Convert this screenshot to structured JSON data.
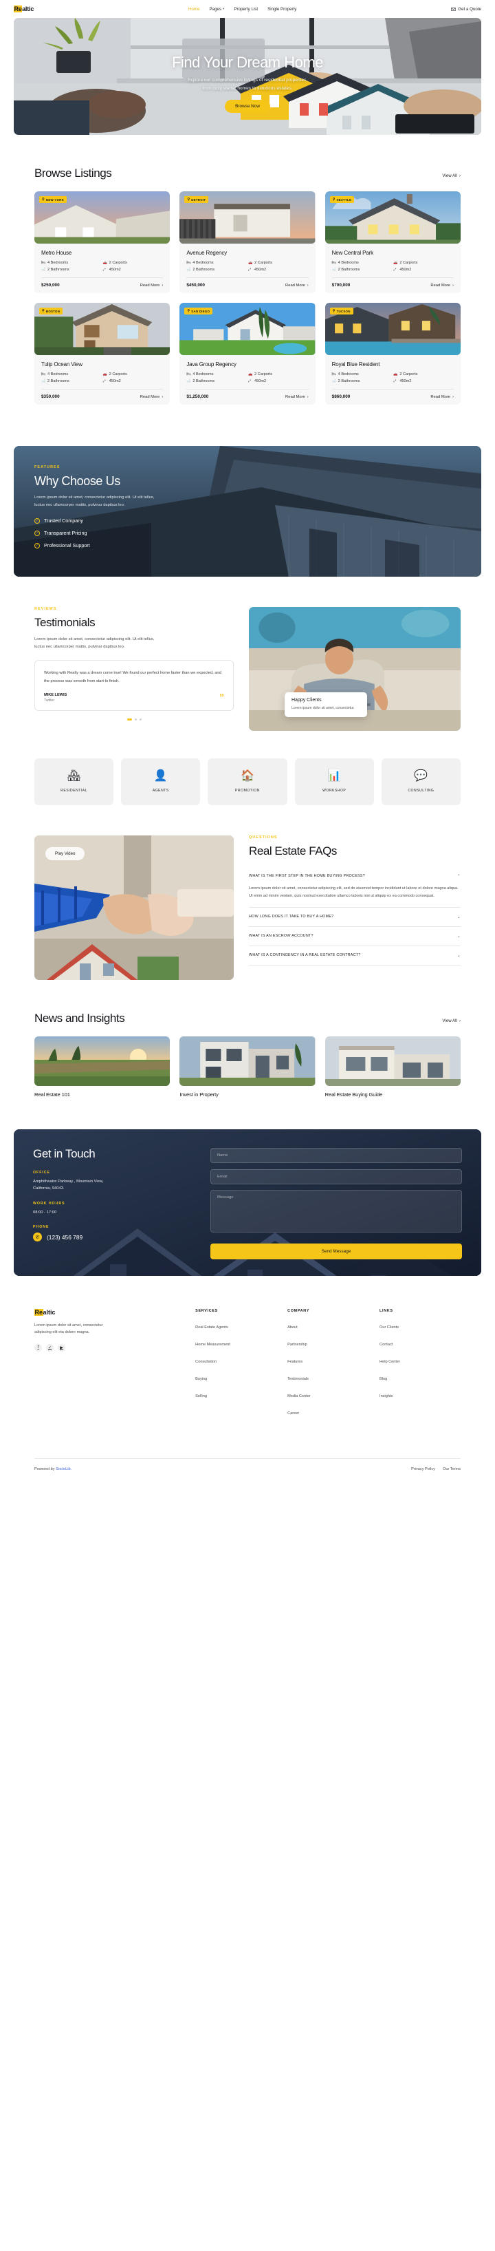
{
  "header": {
    "logo_prefix": "Re",
    "logo_suffix": "altic",
    "nav": [
      {
        "label": "Home",
        "active": true,
        "caret": false
      },
      {
        "label": "Pages",
        "active": false,
        "caret": true
      },
      {
        "label": "Property List",
        "active": false,
        "caret": false
      },
      {
        "label": "Single Property",
        "active": false,
        "caret": false
      }
    ],
    "quote_label": "Get a Quote",
    "quote_icon": "mail-icon"
  },
  "hero": {
    "title": "Find Your Dream Home",
    "subtitle_line1": "Explore our comprehensive listings of residential properties,",
    "subtitle_line2": "from cozy starter homes to luxurious estates.",
    "cta": "Browse Now"
  },
  "listings": {
    "title": "Browse Listings",
    "view_all": "View All",
    "cards": [
      {
        "badge": "NEW YORK",
        "name": "Metro House",
        "bedrooms": "4 Bedrooms",
        "carports": "2 Carports",
        "bathrooms": "2 Bathrooms",
        "area": "450m2",
        "price": "$250,000",
        "read_more": "Read More"
      },
      {
        "badge": "DETROIT",
        "name": "Avenue Regency",
        "bedrooms": "4 Bedrooms",
        "carports": "2 Carports",
        "bathrooms": "2 Bathrooms",
        "area": "450m2",
        "price": "$450,000",
        "read_more": "Read More"
      },
      {
        "badge": "SEATTLE",
        "name": "New Central Park",
        "bedrooms": "4 Bedrooms",
        "carports": "2 Carports",
        "bathrooms": "2 Bathrooms",
        "area": "450m2",
        "price": "$700,000",
        "read_more": "Read More"
      },
      {
        "badge": "BOSTON",
        "name": "Tulip Ocean View",
        "bedrooms": "4 Bedrooms",
        "carports": "2 Carports",
        "bathrooms": "2 Bathrooms",
        "area": "450m2",
        "price": "$350,000",
        "read_more": "Read More"
      },
      {
        "badge": "SAN DIEGO",
        "name": "Java Group Regency",
        "bedrooms": "4 Bedrooms",
        "carports": "2 Carports",
        "bathrooms": "2 Bathrooms",
        "area": "450m2",
        "price": "$1,250,000",
        "read_more": "Read More"
      },
      {
        "badge": "TUCSON",
        "name": "Royal Blue Resident",
        "bedrooms": "4 Bedrooms",
        "carports": "2 Carports",
        "bathrooms": "2 Bathrooms",
        "area": "450m2",
        "price": "$860,000",
        "read_more": "Read More"
      }
    ]
  },
  "why": {
    "eyebrow": "FEATURES",
    "title": "Why Choose Us",
    "desc_line1": "Lorem ipsum dolor sit amet, consectetur adipiscing elit. Ut elit tellus,",
    "desc_line2": "luctus nec ullamcorper mattis, pulvinar dapibus leo.",
    "features": [
      {
        "label": "Trusted Company"
      },
      {
        "label": "Transparent Pricing"
      },
      {
        "label": "Professional Support"
      }
    ]
  },
  "testimonials": {
    "eyebrow": "REVIEWS",
    "title": "Testimonials",
    "subtitle_line1": "Lorem ipsum dolor sit amet, consectetur adipiscing elit. Ut elit tellus,",
    "subtitle_line2": "luctus nec ullamcorper mattis, pulvinar dapibus leo.",
    "quote": "Working with Realty was a dream come true! We found our perfect home faster than we expected, and the process was smooth from start to finish.",
    "author": "MIKE LEWIS",
    "role": "Twitter",
    "happy_title": "Happy Clients",
    "happy_body": "Lorem ipsum dolor sit amet, consectetur."
  },
  "categories": [
    {
      "icon": "house-residential-icon",
      "glyph": "🏘",
      "label": "RESIDENTIAL"
    },
    {
      "icon": "agent-person-icon",
      "glyph": "👤",
      "label": "AGENTS"
    },
    {
      "icon": "megaphone-promotion-icon",
      "glyph": "🏠",
      "label": "PROMOTION"
    },
    {
      "icon": "presentation-workshop-icon",
      "glyph": "📊",
      "label": "WORKSHOP"
    },
    {
      "icon": "chat-consulting-icon",
      "glyph": "💬",
      "label": "CONSULTING"
    }
  ],
  "faq": {
    "play_label": "Play Video",
    "eyebrow": "QUESTIONS",
    "title": "Real Estate FAQs",
    "items": [
      {
        "question": "WHAT IS THE FIRST STEP IN THE HOME BUYING PROCESS?",
        "open": true,
        "answer": "Lorem ipsum dolor sit amet, consectetur adipiscing elit, sed do eiusmod tempor incididunt ut labore et dolore magna aliqua. Ut enim ad minim veniam, quis nostrud exercitation ullamco laboris nisi ut aliquip ex ea commodo consequat."
      },
      {
        "question": "HOW LONG DOES IT TAKE TO BUY A HOME?",
        "open": false,
        "answer": ""
      },
      {
        "question": "WHAT IS AN ESCROW ACCOUNT?",
        "open": false,
        "answer": ""
      },
      {
        "question": "WHAT IS A CONTINGENCY IN A REAL ESTATE CONTRACT?",
        "open": false,
        "answer": ""
      }
    ]
  },
  "news": {
    "title": "News and Insights",
    "view_all": "View All",
    "items": [
      {
        "title": "Real Estate 101"
      },
      {
        "title": "Invest in Property"
      },
      {
        "title": "Real Estate Buying Guide"
      }
    ]
  },
  "contact": {
    "title": "Get in Touch",
    "office_label": "OFFICE",
    "office_line1": "Amphitheatre Parkway , Mountain View,",
    "office_line2": "California, 94043.",
    "hours_label": "WORK HOURS",
    "hours_value": "08:00 - 17:00",
    "phone_label": "PHONE",
    "phone_value": "(123) 456 789",
    "phone_icon": "phone-icon",
    "form": {
      "name_placeholder": "Name",
      "email_placeholder": "Email",
      "message_placeholder": "Message",
      "submit": "Send Message"
    }
  },
  "footer": {
    "logo_prefix": "Re",
    "logo_suffix": "altic",
    "desc_line1": "Lorem ipsum dolor sit amet, consectetur",
    "desc_line2": "adipiscing elit eta dolore magna.",
    "socials": [
      {
        "icon": "facebook-icon",
        "glyph": "f"
      },
      {
        "icon": "twitter-icon",
        "glyph": "✓"
      },
      {
        "icon": "youtube-icon",
        "glyph": "▶"
      }
    ],
    "columns": [
      {
        "heading": "SERVICES",
        "links": [
          "Real Estate Agents",
          "Home Measurement",
          "Consultation",
          "Buying",
          "Selling"
        ]
      },
      {
        "heading": "COMPANY",
        "links": [
          "About",
          "Partnership",
          "Features",
          "Testimonials",
          "Media Center",
          "Career"
        ]
      },
      {
        "heading": "LINKS",
        "links": [
          "Our Clients",
          "Contact",
          "Help Center",
          "Blog",
          "Insights"
        ]
      }
    ],
    "powered_prefix": "Powered by ",
    "powered_brand": "SocioLib.",
    "legal": [
      "Privacy Policy",
      "Our Terms"
    ]
  }
}
